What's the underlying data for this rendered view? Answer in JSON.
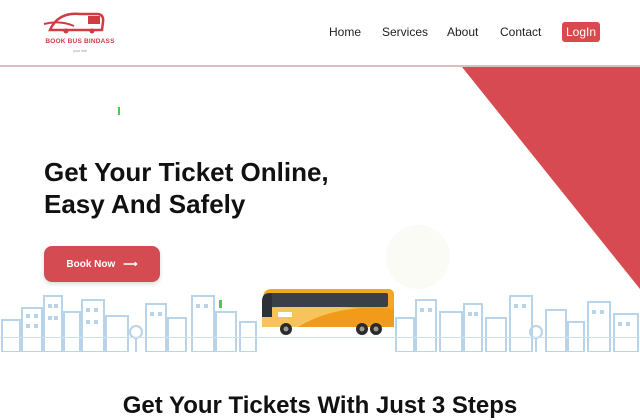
{
  "logo": {
    "name": "BOOK BUS BINDASS",
    "tagline": "your ride",
    "icon": "bus-logo-icon"
  },
  "nav": {
    "items": [
      {
        "label": "Home"
      },
      {
        "label": "Services"
      },
      {
        "label": "About"
      },
      {
        "label": "Contact"
      }
    ],
    "login_label": "LogIn"
  },
  "hero": {
    "headline_line1": "Get Your Ticket Online,",
    "headline_line2": "Easy And Safely",
    "cta_label": "Book Now",
    "cta_icon": "arrow-right-icon"
  },
  "section": {
    "title": "Get Your Tickets With Just 3 Steps"
  },
  "colors": {
    "accent": "#d44b52",
    "shape": "#d74a52",
    "city": "#b9d3e8"
  }
}
